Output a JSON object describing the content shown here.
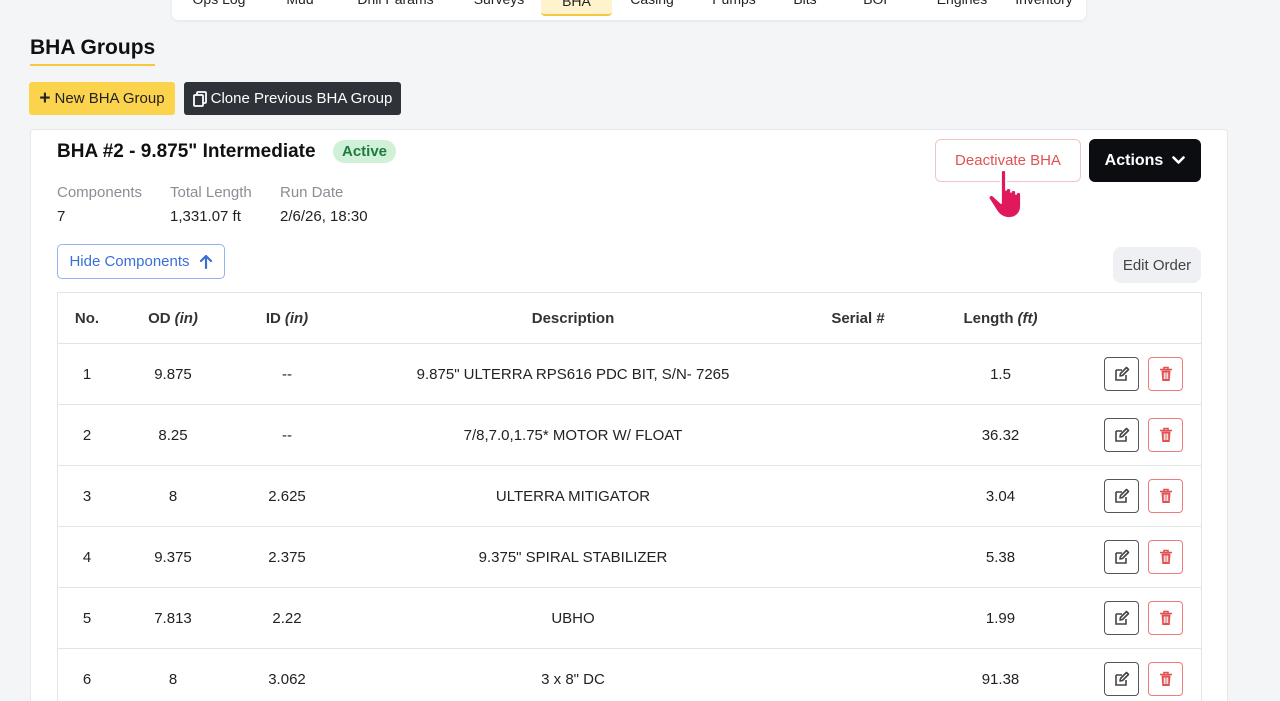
{
  "tabs": [
    {
      "label": "Ops Log",
      "active": false
    },
    {
      "label": "Mud",
      "active": false
    },
    {
      "label": "Drill Params",
      "active": false
    },
    {
      "label": "Surveys",
      "active": false
    },
    {
      "label": "BHA",
      "active": true
    },
    {
      "label": "Casing",
      "active": false
    },
    {
      "label": "Pumps",
      "active": false
    },
    {
      "label": "Bits",
      "active": false
    },
    {
      "label": "BOP",
      "active": false
    },
    {
      "label": "Engines",
      "active": false
    },
    {
      "label": "Inventory",
      "active": false
    }
  ],
  "page": {
    "title": "BHA Groups",
    "new_button": "New BHA Group",
    "clone_button": "Clone Previous BHA Group"
  },
  "bha": {
    "title": "BHA #2 - 9.875\" Intermediate",
    "status": "Active",
    "stats": {
      "components_label": "Components",
      "components_value": "7",
      "length_label": "Total Length",
      "length_value": "1,331.07 ft",
      "run_label": "Run Date",
      "run_value": "2/6/26, 18:30"
    },
    "deactivate_button": "Deactivate BHA",
    "actions_button": "Actions",
    "hide_button": "Hide Components",
    "edit_order_button": "Edit Order"
  },
  "table": {
    "headers": {
      "no": "No.",
      "od": "OD",
      "od_unit": "(in)",
      "id": "ID",
      "id_unit": "(in)",
      "desc": "Description",
      "serial": "Serial #",
      "len": "Length",
      "len_unit": "(ft)"
    },
    "rows": [
      {
        "no": "1",
        "od": "9.875",
        "id": "--",
        "desc": "9.875\" ULTERRA RPS616 PDC BIT, S/N- 7265",
        "serial": "",
        "len": "1.5"
      },
      {
        "no": "2",
        "od": "8.25",
        "id": "--",
        "desc": "7/8,7.0,1.75* MOTOR W/ FLOAT",
        "serial": "",
        "len": "36.32"
      },
      {
        "no": "3",
        "od": "8",
        "id": "2.625",
        "desc": "ULTERRA MITIGATOR",
        "serial": "",
        "len": "3.04"
      },
      {
        "no": "4",
        "od": "9.375",
        "id": "2.375",
        "desc": "9.375\" SPIRAL STABILIZER",
        "serial": "",
        "len": "5.38"
      },
      {
        "no": "5",
        "od": "7.813",
        "id": "2.22",
        "desc": "UBHO",
        "serial": "",
        "len": "1.99"
      },
      {
        "no": "6",
        "od": "8",
        "id": "3.062",
        "desc": "3 x 8\" DC",
        "serial": "",
        "len": "91.38"
      }
    ]
  },
  "colors": {
    "accent": "#fcd34d",
    "danger": "#e05252",
    "link": "#3b6fd8",
    "success_bg": "#d1f0d8"
  },
  "icons": [
    "plus-icon",
    "copy-icon",
    "arrow-up-icon",
    "chevron-down-icon",
    "pointer-hand-icon",
    "edit-icon",
    "trash-icon"
  ]
}
